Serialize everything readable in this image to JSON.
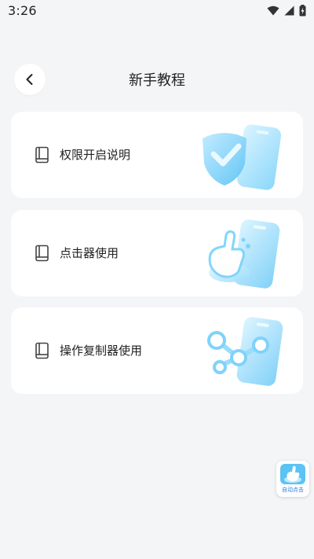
{
  "status_bar": {
    "time": "3:26",
    "icons": [
      "wifi-icon",
      "signal-icon",
      "battery-icon"
    ]
  },
  "header": {
    "title": "新手教程",
    "back_icon": "chevron-left-icon"
  },
  "cards": [
    {
      "label": "权限开启说明",
      "icon": "book-icon",
      "illustration": "shield-phone-illustration"
    },
    {
      "label": "点击器使用",
      "icon": "book-icon",
      "illustration": "tap-hand-phone-illustration"
    },
    {
      "label": "操作复制器使用",
      "icon": "book-icon",
      "illustration": "connect-nodes-phone-illustration"
    }
  ],
  "float_widget": {
    "label": "自动点击",
    "icon": "auto-click-hand-icon"
  },
  "colors": {
    "background": "#f4f5f7",
    "card": "#ffffff",
    "accent": "#5cc3f5",
    "text": "#222222"
  }
}
